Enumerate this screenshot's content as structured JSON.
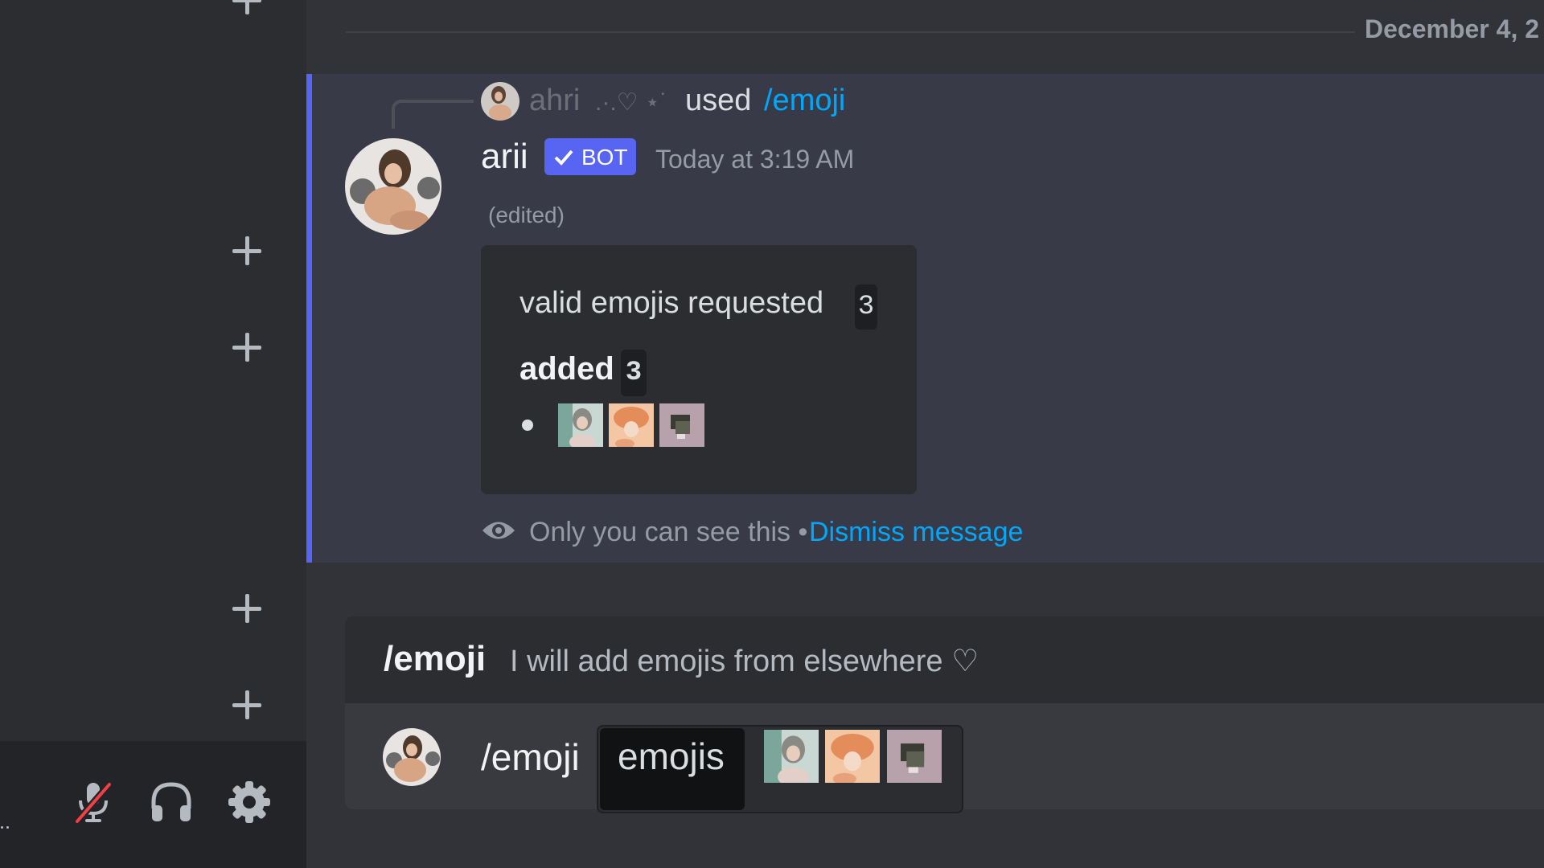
{
  "date_divider": "December 4, 2",
  "message": {
    "reply": {
      "username": "ahri",
      "decoration": ".·.♡ ⋆˙",
      "used_label": "used",
      "command": "/emoji"
    },
    "author": "arii",
    "bot_tag": "BOT",
    "timestamp": "Today at 3:19 AM",
    "edited": "(edited)",
    "embed": {
      "line1_label": "valid emojis requested",
      "line1_count": "3",
      "line2_label": "added",
      "line2_count": "3",
      "emojis": [
        "emoji-1",
        "emoji-2",
        "emoji-3"
      ]
    },
    "ephemeral_note": "Only you can see this •",
    "dismiss_label": "Dismiss message"
  },
  "command_popup": {
    "name": "/emoji",
    "description": "I will add emojis from elsewhere ♡"
  },
  "input": {
    "command": "/emoji",
    "option_name": "emojis"
  },
  "user_controls": {
    "icons": [
      "mic-muted-icon",
      "headphones-icon",
      "gear-icon"
    ]
  },
  "colors": {
    "accent": "#5865f2",
    "link": "#00a8fc",
    "background": "#313338",
    "sidebar": "#2b2d31",
    "mute_red": "#f23f43"
  }
}
